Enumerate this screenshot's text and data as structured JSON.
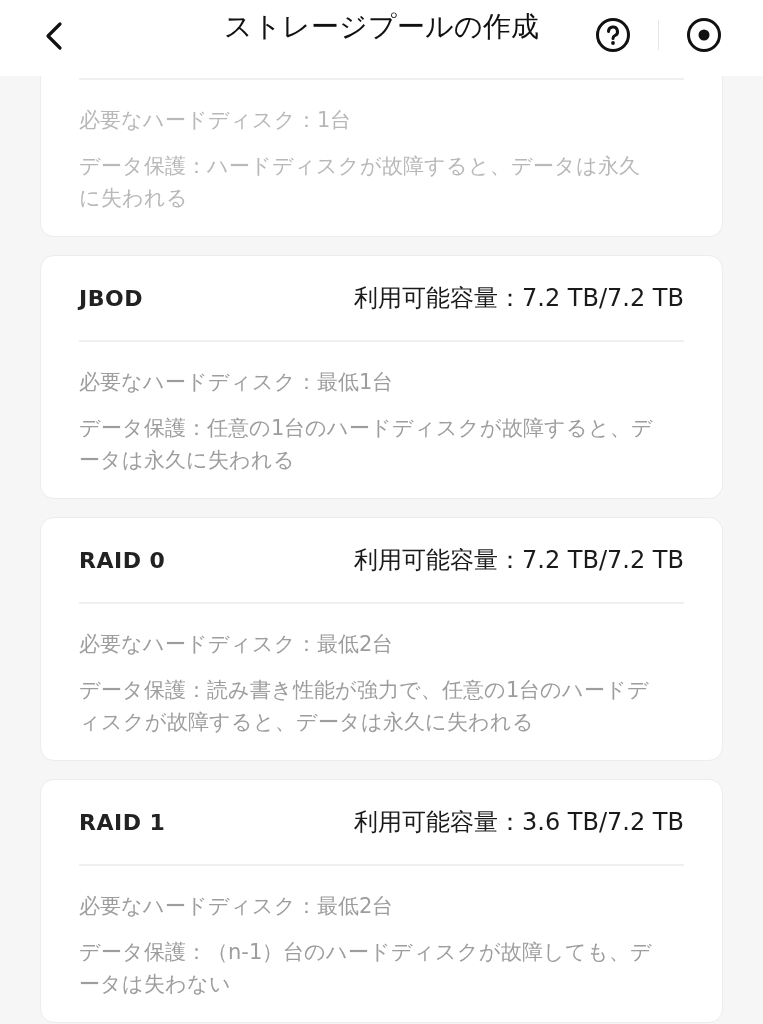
{
  "header": {
    "title": "ストレージプールの作成"
  },
  "pools": [
    {
      "disabled": true,
      "disks": "必要なハードディスク：1台",
      "protection": "データ保護：ハードディスクが故障すると、データは永久に失われる"
    },
    {
      "name": "JBOD",
      "capacity": "利用可能容量：7.2 TB/7.2 TB",
      "disabled": false,
      "disks": "必要なハードディスク：最低1台",
      "protection": "データ保護：任意の1台のハードディスクが故障すると、データは永久に失われる"
    },
    {
      "name": "RAID 0",
      "capacity": "利用可能容量：7.2 TB/7.2 TB",
      "disabled": false,
      "disks": "必要なハードディスク：最低2台",
      "protection": "データ保護：読み書き性能が強力で、任意の1台のハードディスクが故障すると、データは永久に失われる"
    },
    {
      "name": "RAID 1",
      "capacity": "利用可能容量：3.6 TB/7.2 TB",
      "disabled": false,
      "disks": "必要なハードディスク：最低2台",
      "protection": "データ保護：（n-1）台のハードディスクが故障しても、データは失わない"
    }
  ]
}
